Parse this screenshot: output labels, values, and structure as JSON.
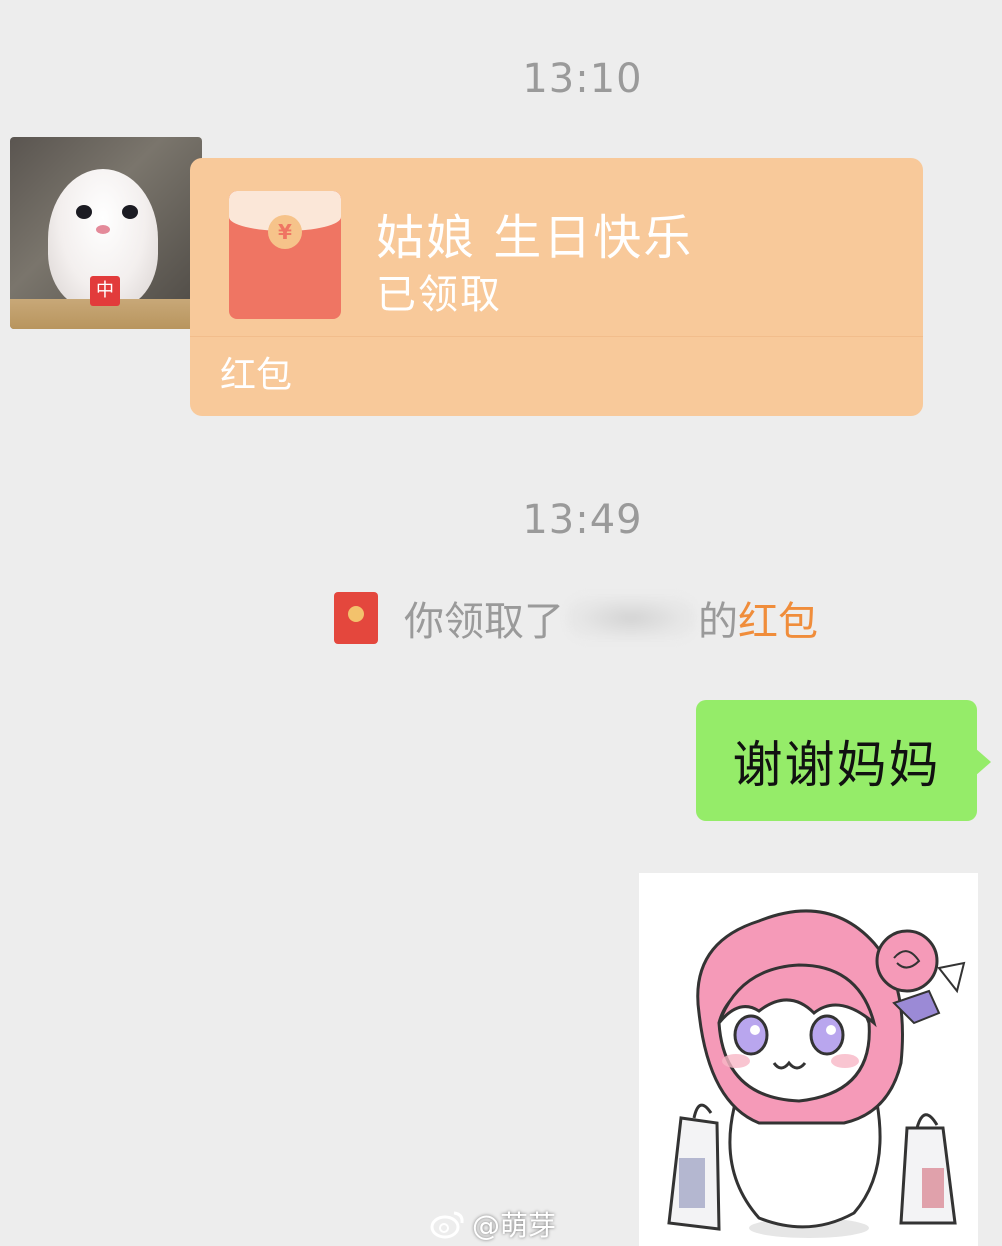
{
  "timestamps": {
    "first": "13:10",
    "second": "13:49"
  },
  "red_packet": {
    "coin_glyph": "¥",
    "title": "姑娘 生日快乐",
    "status": "已领取",
    "label": "红包",
    "color": "#f8c99a"
  },
  "avatar": {
    "badge": "中"
  },
  "system_notice": {
    "prefix": "你领取了",
    "suffix": "的",
    "link": "红包",
    "link_color": "#f08d3b"
  },
  "my_message": {
    "text": "谢谢妈妈",
    "bubble_color": "#95ec69"
  },
  "watermark": {
    "text": "@萌芽",
    "icon": "weibo-logo"
  }
}
